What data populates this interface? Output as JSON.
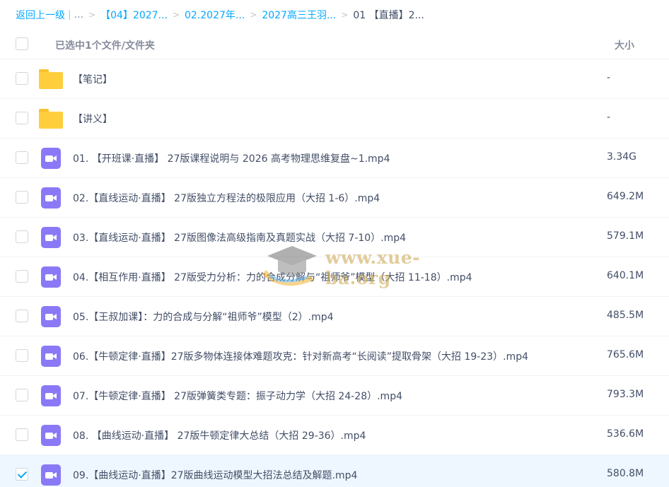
{
  "breadcrumb": {
    "back": "返回上一级",
    "bar": "|",
    "dots": "...",
    "sep": ">",
    "crumbs": [
      "【04】2027...",
      "02.2027年...",
      "2027高三王羽..."
    ],
    "current": "01 【直播】2..."
  },
  "header": {
    "selected_text": "已选中1个文件/文件夹",
    "size_label": "大小"
  },
  "files": [
    {
      "type": "folder",
      "name": "【笔记】",
      "size": "-"
    },
    {
      "type": "folder",
      "name": "【讲义】",
      "size": "-"
    },
    {
      "type": "video",
      "name": "01. 【开班课·直播】 27版课程说明与 2026 高考物理思维复盘~1.mp4",
      "size": "3.34G"
    },
    {
      "type": "video",
      "name": "02.【直线运动·直播】 27版独立方程法的极限应用（大招 1-6）.mp4",
      "size": "649.2M"
    },
    {
      "type": "video",
      "name": "03.【直线运动·直播】 27版图像法高级指南及真题实战（大招 7-10）.mp4",
      "size": "579.1M"
    },
    {
      "type": "video",
      "name": "04.【相互作用·直播】 27版受力分析：力的合成分解与“祖师爷”模型（大招 11-18）.mp4",
      "size": "640.1M"
    },
    {
      "type": "video",
      "name": "05.【王叔加课】：力的合成与分解“祖师爷”模型（2）.mp4",
      "size": "485.5M"
    },
    {
      "type": "video",
      "name": "06.【牛顿定律·直播】27版多物体连接体难题攻克：针对新高考“长阅读”提取骨架（大招 19-23）.mp4",
      "size": "765.6M"
    },
    {
      "type": "video",
      "name": "07.【牛顿定律·直播】 27版弹簧类专题：振子动力学（大招 24-28）.mp4",
      "size": "793.3M"
    },
    {
      "type": "video",
      "name": "08. 【曲线运动·直播】 27版牛顿定律大总结（大招 29-36）.mp4",
      "size": "536.6M"
    },
    {
      "type": "video",
      "name": "09.【曲线运动·直播】27版曲线运动模型大招法总结及解题.mp4",
      "size": "580.8M",
      "selected": true
    }
  ],
  "watermark": {
    "text": "www.xue-ba.org"
  },
  "colors": {
    "link": "#06a7ff",
    "folder": "#ffce3d",
    "video": "#8a79f7",
    "selected_row": "#eef7ff"
  }
}
